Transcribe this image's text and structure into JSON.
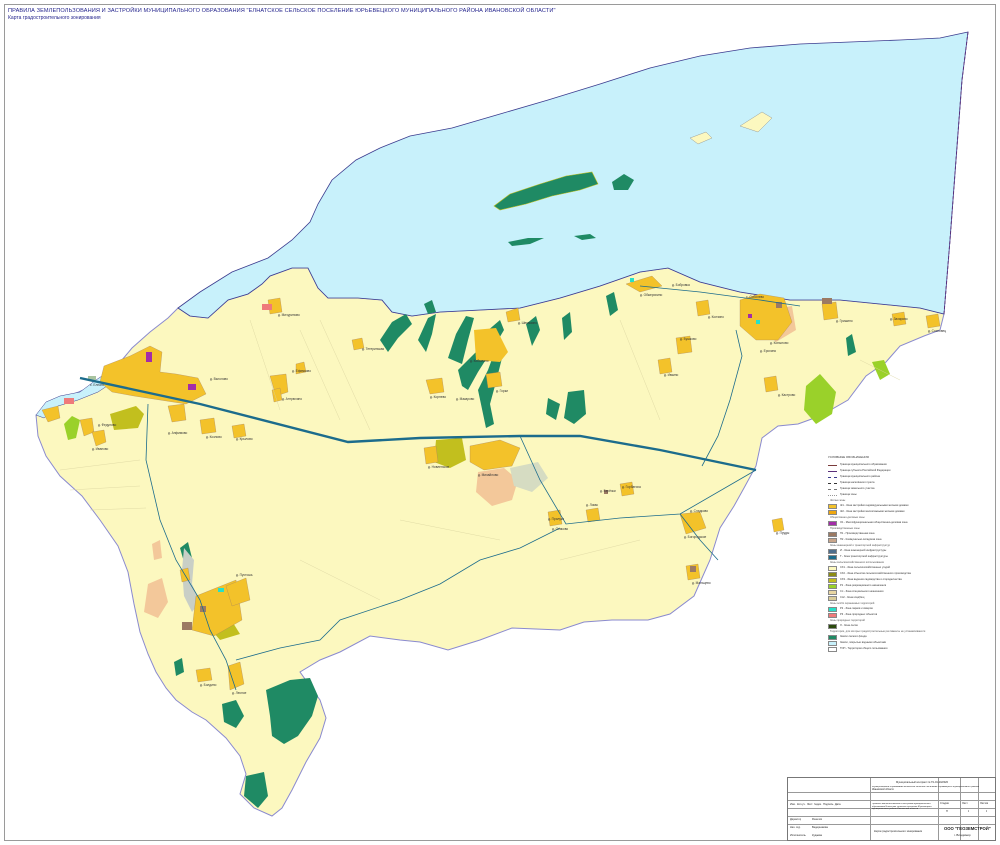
{
  "header": {
    "title": "ПРАВИЛА ЗЕМЛЕПОЛЬЗОВАНИЯ И ЗАСТРОЙКИ МУНИЦИПАЛЬНОГО ОБРАЗОВАНИЯ \"ЕЛНАТСКОЕ СЕЛЬСКОЕ ПОСЕЛЕНИЕ ЮРЬЕВЕЦКОГО МУНИЦИПАЛЬНОГО РАЙОНА ИВАНОВСКОЙ ОБЛАСТИ\"",
    "subtitle": "Карта градостроительного зонирования"
  },
  "colors": {
    "territory": "#fcf8bf",
    "water": "#c8f1fb",
    "residential": "#f3c22a",
    "forest": "#1f8a64",
    "agricultural": "#c2bf1e",
    "industrial": "#9c7a63",
    "public": "#b13ab4",
    "road": "#1c6c8c",
    "boundary": "#3b3b8e"
  },
  "places": [
    "д. Мичуриново",
    "д. Ефимково",
    "д. Тетеринская",
    "д. Антрюхино",
    "д. Выголово",
    "д. Анфимово",
    "д. Козлово",
    "д. Крылово",
    "с. Елнать",
    "д. Федулово",
    "д. Иваново",
    "д. Корнево",
    "д. Макарово",
    "д. Горки",
    "д. Кобылино",
    "д. Шемякино",
    "д. Обжерихино",
    "д. Бобровка",
    "д. Колчино",
    "с. Соболево",
    "д. Бушково",
    "д. Ивкино",
    "д. Копылово",
    "д. Ерохино",
    "д. Гришино",
    "д. Захарово",
    "д. Сосновец",
    "д. Кастрово",
    "д. Новленское",
    "д. Михайлово",
    "д. Осиково",
    "д. Ломы",
    "д. Горбатиха",
    "д. Богородское",
    "д. Сладково",
    "д. Пруды",
    "д. Мальцево",
    "д. Пустошь",
    "д. Болдино",
    "д. Лесное",
    "д. Прилуки",
    "д. Берёзки"
  ],
  "legend": {
    "heading": "УСЛОВНЫЕ ОБОЗНАЧЕНИЯ",
    "items": [
      {
        "kind": "line",
        "color": "#7a3b3b",
        "style": "solid",
        "label": "Граница муниципального образования"
      },
      {
        "kind": "line",
        "color": "#5a2f7a",
        "style": "solid",
        "label": "Граница субъекта Российской Федерации"
      },
      {
        "kind": "line",
        "color": "#3b3b8e",
        "style": "dashed",
        "label": "Граница муниципального района"
      },
      {
        "kind": "line",
        "color": "#333333",
        "style": "dashed",
        "label": "Граница населённого пункта"
      },
      {
        "kind": "line",
        "color": "#777777",
        "style": "dashed",
        "label": "Граница земельного участка"
      },
      {
        "kind": "line",
        "color": "#999999",
        "style": "dotted",
        "label": "Граница зоны"
      },
      {
        "kind": "section",
        "label": "Жилые зоны"
      },
      {
        "kind": "box",
        "color": "#f3c22a",
        "label": "Ж1 - Зона застройки индивидуальными жилыми домами"
      },
      {
        "kind": "box",
        "color": "#f0a70e",
        "label": "Ж2 - Зона застройки малоэтажными жилыми домами"
      },
      {
        "kind": "section",
        "label": "Общественно-деловые зоны"
      },
      {
        "kind": "box",
        "color": "#a32ca8",
        "label": "О1 - Многофункциональная общественно-деловая зона"
      },
      {
        "kind": "section",
        "label": "Производственные зоны"
      },
      {
        "kind": "box",
        "color": "#9c7a63",
        "label": "П1 - Производственная зона"
      },
      {
        "kind": "box",
        "color": "#c8a58a",
        "label": "П2 - Коммунально-складская зона"
      },
      {
        "kind": "section",
        "label": "Зоны инженерной и транспортной инфраструктур"
      },
      {
        "kind": "box",
        "color": "#4f6e8c",
        "label": "И - Зона инженерной инфраструктуры"
      },
      {
        "kind": "box",
        "color": "#1c6c8c",
        "label": "Т - Зона транспортной инфраструктуры"
      },
      {
        "kind": "section",
        "label": "Зоны сельскохозяйственного использования"
      },
      {
        "kind": "box",
        "color": "#fcf8bf",
        "label": "СХ1 - Зона сельскохозяйственных угодий"
      },
      {
        "kind": "box",
        "color": "#8c8c14",
        "label": "СХ2 - Зона объектов сельскохозяйственного производства"
      },
      {
        "kind": "box",
        "color": "#c2bf1e",
        "label": "СХ3 - Зона ведения садоводства и огородничества"
      },
      {
        "kind": "box",
        "color": "#9ad12a",
        "label": "Р1 - Зона рекреационного назначения"
      },
      {
        "kind": "box",
        "color": "#e8d6a3",
        "label": "Сп - Зона специального назначения"
      },
      {
        "kind": "box",
        "color": "#d9cc9a",
        "label": "Сп2 - Зона кладбищ"
      },
      {
        "kind": "section",
        "label": "Зоны особо охраняемых территорий"
      },
      {
        "kind": "box",
        "color": "#27e0c8",
        "label": "Р2 - Зона парков и скверов"
      },
      {
        "kind": "box",
        "color": "#ef7a7a",
        "label": "Р3 - Зона природных объектов"
      },
      {
        "kind": "section",
        "label": "Зоны природных территорий"
      },
      {
        "kind": "box",
        "color": "#2b4a0e",
        "label": "Л - Зона лесов"
      },
      {
        "kind": "section",
        "label": "Территории, для которых градостроительные регламенты не устанавливаются"
      },
      {
        "kind": "box",
        "color": "#1f8a64",
        "label": "Земли лесного фонда"
      },
      {
        "kind": "box",
        "color": "#c8f1fb",
        "label": "Земли, покрытые водными объектами"
      },
      {
        "kind": "box",
        "color": "#ffffff",
        "label": "ТОП - Территории общего пользования"
      }
    ]
  },
  "stamp": {
    "project_code": "Муниципальный контракт № ГК-01-10/2020",
    "org_line": "Муниципальное образование Елнатское сельское поселение Юрьевецкого муниципального района Ивановской области",
    "doc_title": "Правила землепользования и застройки муниципального образования Елнатское сельское поселение Юрьевецкого муниципального района Ивановской области",
    "sheet_title": "Карта градостроительного зонирования",
    "company": "ООО \"ГЕОЗЕМСТРОЙ\"",
    "city": "г. Владимир",
    "col_headers": [
      "Изм.",
      "Кол.уч.",
      "Лист",
      "№док.",
      "Подпись",
      "Дата"
    ],
    "stage_headers": [
      "Стадия",
      "Лист",
      "Листов"
    ],
    "stage_values": [
      "П",
      "1",
      "1"
    ],
    "roles": [
      "Директор",
      "Нач. отд.",
      "Исполнитель"
    ],
    "names": [
      "Решетов",
      "Ведерникова",
      "Кудаева"
    ]
  }
}
